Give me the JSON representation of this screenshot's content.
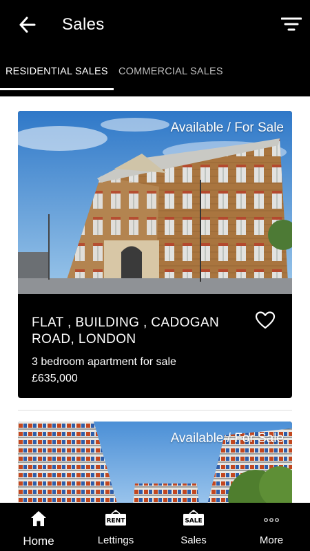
{
  "app_bar": {
    "title": "Sales",
    "back_icon": "arrow-left-icon",
    "filter_icon": "filter-icon"
  },
  "tabs": [
    {
      "label": "RESIDENTIAL SALES",
      "active": true
    },
    {
      "label": "COMMERCIAL SALES",
      "active": false
    }
  ],
  "listings": [
    {
      "status": "Available / For Sale",
      "address": "FLAT , BUILDING , CADOGAN ROAD, LONDON",
      "description": "3 bedroom apartment for sale",
      "price": "£635,000",
      "favorite_icon": "heart-outline-icon"
    },
    {
      "status": "Available / For Sale"
    }
  ],
  "bottom_nav": [
    {
      "label": "Home",
      "icon": "home-icon",
      "selected": true
    },
    {
      "label": "Lettings",
      "icon": "rent-sign-icon",
      "icon_text": "RENT"
    },
    {
      "label": "Sales",
      "icon": "sale-sign-icon",
      "icon_text": "SALE"
    },
    {
      "label": "More",
      "icon": "more-dots-icon"
    }
  ],
  "colors": {
    "bar_background": "#000000",
    "text_primary": "#ffffff",
    "tab_inactive": "#bdbdbd",
    "page_background": "#ffffff"
  }
}
